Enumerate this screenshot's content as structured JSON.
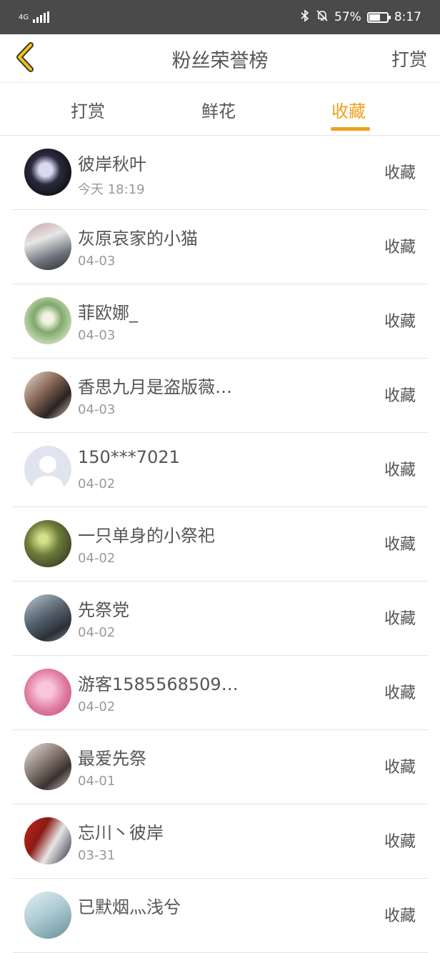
{
  "status_bar": {
    "network": "4G",
    "battery": "57%",
    "time": "8:17",
    "icons": [
      "signal-icon",
      "bluetooth-icon",
      "notifications-off-icon",
      "battery-icon"
    ]
  },
  "header": {
    "title": "粉丝荣誉榜",
    "right_action": "打赏",
    "back_icon": "chevron-left-icon"
  },
  "tabs": [
    {
      "label": "打赏",
      "active": false
    },
    {
      "label": "鲜花",
      "active": false
    },
    {
      "label": "收藏",
      "active": true
    }
  ],
  "accent_color": "#f0a020",
  "fans": [
    {
      "name": "彼岸秋叶",
      "date": "今天 18:19",
      "action": "收藏"
    },
    {
      "name": "灰原哀家的小猫",
      "date": "04-03",
      "action": "收藏"
    },
    {
      "name": "菲欧娜_",
      "date": "04-03",
      "action": "收藏"
    },
    {
      "name": "香思九月是盗版薇…",
      "date": "04-03",
      "action": "收藏"
    },
    {
      "name": "150***7021",
      "date": "04-02",
      "action": "收藏"
    },
    {
      "name": "一只单身的小祭祀",
      "date": "04-02",
      "action": "收藏"
    },
    {
      "name": "先祭党",
      "date": "04-02",
      "action": "收藏"
    },
    {
      "name": "游客1585568509…",
      "date": "04-02",
      "action": "收藏"
    },
    {
      "name": "最爱先祭",
      "date": "04-01",
      "action": "收藏"
    },
    {
      "name": "忘川丶彼岸",
      "date": "03-31",
      "action": "收藏"
    },
    {
      "name": "已默烟灬浅兮",
      "date": "",
      "action": "收藏"
    }
  ]
}
